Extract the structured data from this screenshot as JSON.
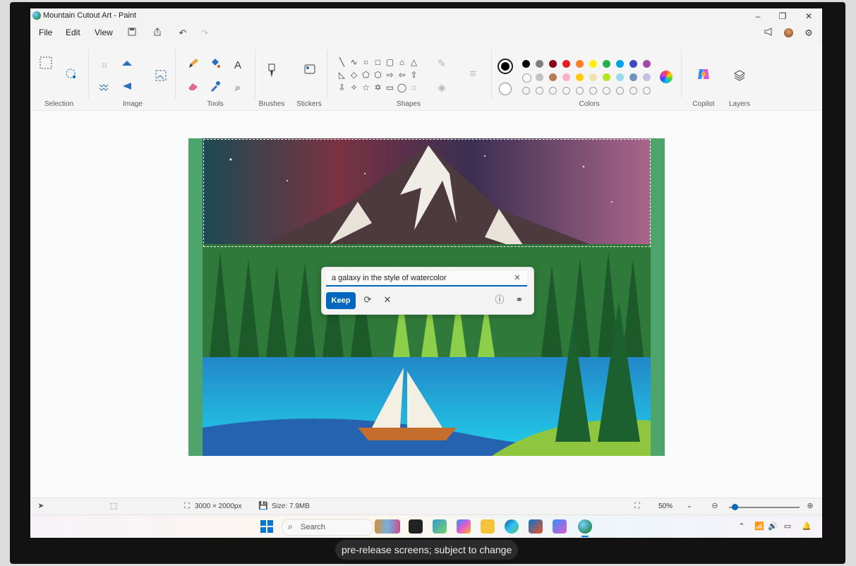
{
  "window": {
    "title": "Mountain Cutout Art - Paint",
    "icon": "paint-app-icon",
    "controls": {
      "minimize": "–",
      "restore": "❐",
      "close": "✕"
    }
  },
  "menu": {
    "file": "File",
    "edit": "Edit",
    "view": "View",
    "quick_actions": [
      "save-icon",
      "share-icon",
      "undo-icon",
      "redo-icon"
    ]
  },
  "ribbon": {
    "groups": {
      "selection": "Selection",
      "image": "Image",
      "tools": "Tools",
      "brushes": "Brushes",
      "stickers": "Stickers",
      "shapes": "Shapes",
      "colors": "Colors",
      "copilot": "Copilot",
      "layers": "Layers"
    },
    "tool_text_glyph": "A",
    "colors": {
      "primary": "#000000",
      "secondary": "#ffffff",
      "palette_row1": [
        "#000000",
        "#7f7f7f",
        "#880015",
        "#ed1c24",
        "#ff7f27",
        "#fff200",
        "#22b14c",
        "#00a2e8",
        "#3f48cc",
        "#a349a4"
      ],
      "palette_row2": [
        "#ffffff",
        "#c3c3c3",
        "#b97a57",
        "#ffaec9",
        "#ffc90e",
        "#efe4b0",
        "#b5e61d",
        "#99d9ea",
        "#7092be",
        "#c8bfe7"
      ]
    }
  },
  "canvas": {
    "description_colors": {
      "sky": "#3a3358",
      "forest": "#2f7a3a",
      "lake": "#1aa7d8",
      "border": "#4ea56b"
    }
  },
  "generative_fill": {
    "prompt_value": "a galaxy in the style of watercolor",
    "keep_label": "Keep",
    "icons": [
      "regenerate-icon",
      "discard-icon",
      "info-icon",
      "feedback-icon"
    ]
  },
  "status": {
    "dimensions": "3000 × 2000px",
    "size": "Size: 7.9MB",
    "zoom": "50%",
    "zoom_fraction": 0.05
  },
  "taskbar": {
    "search_placeholder": "Search",
    "accent": "#0078d4"
  },
  "caption": "pre-release screens; subject to change"
}
